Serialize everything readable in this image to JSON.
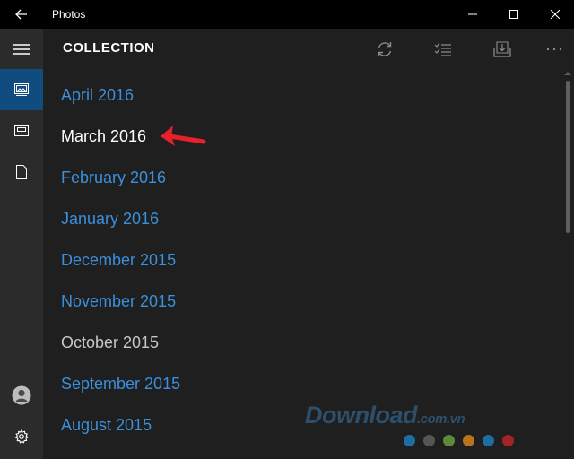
{
  "window": {
    "title": "Photos"
  },
  "header": {
    "title": "COLLECTION"
  },
  "nav": {
    "items": [
      {
        "name": "menu",
        "icon": "hamburger-icon"
      },
      {
        "name": "collection",
        "icon": "photo-collection-icon",
        "selected": true
      },
      {
        "name": "albums",
        "icon": "album-icon"
      },
      {
        "name": "folders",
        "icon": "folder-icon"
      },
      {
        "name": "account",
        "icon": "account-icon"
      },
      {
        "name": "settings",
        "icon": "gear-icon"
      }
    ]
  },
  "toolbar": {
    "icons": [
      "refresh-icon",
      "select-icon",
      "import-icon",
      "more-icon"
    ],
    "more_label": "..."
  },
  "months": [
    {
      "label": "April 2016",
      "style": "link"
    },
    {
      "label": "March 2016",
      "style": "current"
    },
    {
      "label": "February 2016",
      "style": "link"
    },
    {
      "label": "January 2016",
      "style": "link"
    },
    {
      "label": "December 2015",
      "style": "link"
    },
    {
      "label": "November 2015",
      "style": "link"
    },
    {
      "label": "October 2015",
      "style": "plain"
    },
    {
      "label": "September 2015",
      "style": "link"
    },
    {
      "label": "August 2015",
      "style": "link"
    }
  ],
  "watermark": {
    "text": "Download",
    "domain": ".com.vn",
    "dot_colors": [
      "#1d6fa3",
      "#555555",
      "#5a8a3a",
      "#b8741a",
      "#1d6fa3",
      "#a32424"
    ]
  },
  "colors": {
    "link": "#3b8fdc",
    "nav_selected": "#104c80",
    "annotation_arrow": "#e8202a"
  }
}
